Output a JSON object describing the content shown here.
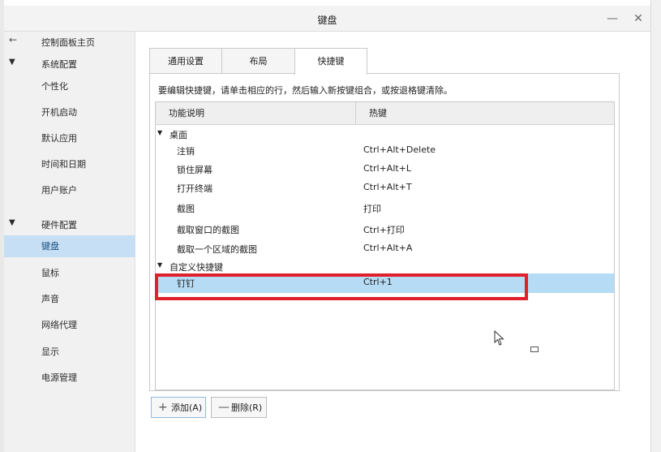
{
  "window": {
    "title": "键盘",
    "minimize_symbol": "—",
    "close_symbol": "✕"
  },
  "sidebar": {
    "back_icon": "←",
    "items": [
      {
        "label": "控制面板主页",
        "kind": "home"
      },
      {
        "label": "系统配置",
        "kind": "group"
      },
      {
        "label": "个性化",
        "kind": "item"
      },
      {
        "label": "开机启动",
        "kind": "item"
      },
      {
        "label": "默认应用",
        "kind": "item"
      },
      {
        "label": "时间和日期",
        "kind": "item"
      },
      {
        "label": "用户账户",
        "kind": "item"
      },
      {
        "label": "硬件配置",
        "kind": "group"
      },
      {
        "label": "键盘",
        "kind": "item",
        "selected": true
      },
      {
        "label": "鼠标",
        "kind": "item"
      },
      {
        "label": "声音",
        "kind": "item"
      },
      {
        "label": "网络代理",
        "kind": "item"
      },
      {
        "label": "显示",
        "kind": "item"
      },
      {
        "label": "电源管理",
        "kind": "item"
      }
    ]
  },
  "tabs": [
    {
      "label": "通用设置"
    },
    {
      "label": "布局"
    },
    {
      "label": "快捷键",
      "active": true
    }
  ],
  "shortcuts": {
    "hint": "要编辑快捷键，请单击相应的行，然后输入新按键组合，或按退格键清除。",
    "columns": [
      "功能说明",
      "热键"
    ],
    "groups": [
      {
        "name": "桌面",
        "rows": [
          {
            "action": "注销",
            "hotkey": "Ctrl+Alt+Delete"
          },
          {
            "action": "锁住屏幕",
            "hotkey": "Ctrl+Alt+L"
          },
          {
            "action": "打开终端",
            "hotkey": "Ctrl+Alt+T"
          },
          {
            "action": "截图",
            "hotkey": "打印"
          },
          {
            "action": "截取窗口的截图",
            "hotkey": "Ctrl+打印"
          },
          {
            "action": "截取一个区域的截图",
            "hotkey": "Ctrl+Alt+A"
          }
        ]
      },
      {
        "name": "自定义快捷键",
        "rows": [
          {
            "action": "钉钉",
            "hotkey": "Ctrl+1",
            "selected": true
          }
        ]
      }
    ]
  },
  "buttons": {
    "add": {
      "symbol": "+",
      "label": "添加(A)"
    },
    "remove": {
      "symbol": "—",
      "label": "删除(R)"
    }
  },
  "colors": {
    "selection": "#b5dcf4",
    "sidebar_selection": "#c7dff4",
    "highlight_box": "#e0212b"
  }
}
